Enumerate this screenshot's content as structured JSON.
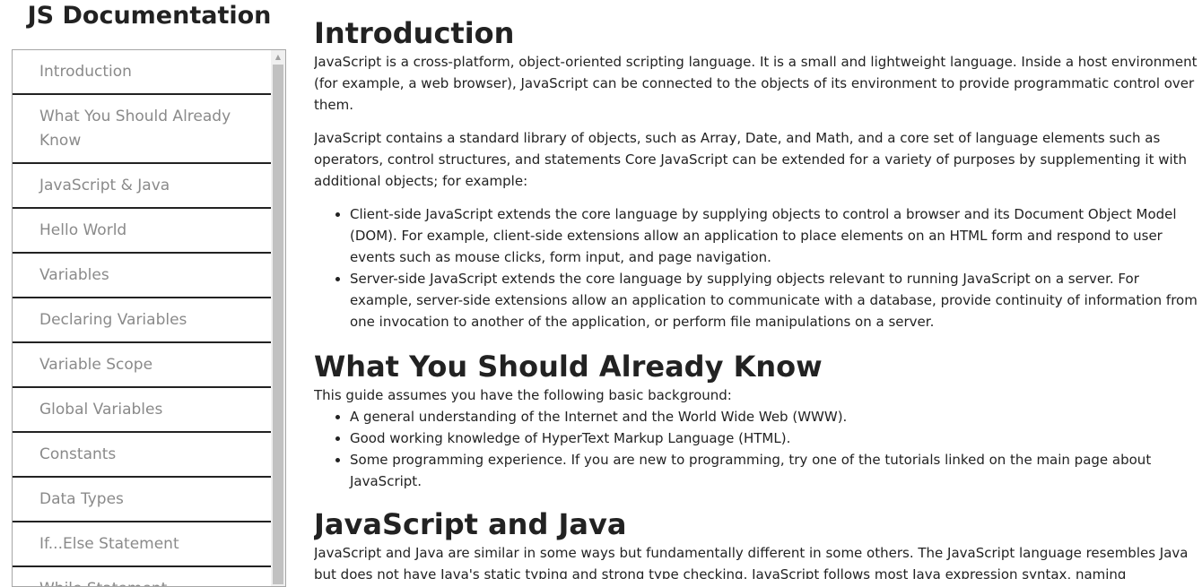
{
  "nav": {
    "title": "JS Documentation",
    "items": [
      {
        "label": "Introduction"
      },
      {
        "label": "What You Should Already Know"
      },
      {
        "label": "JavaScript & Java"
      },
      {
        "label": "Hello World"
      },
      {
        "label": "Variables"
      },
      {
        "label": "Declaring Variables"
      },
      {
        "label": "Variable Scope"
      },
      {
        "label": "Global Variables"
      },
      {
        "label": "Constants"
      },
      {
        "label": "Data Types"
      },
      {
        "label": "If...Else Statement"
      },
      {
        "label": "While Statement"
      }
    ]
  },
  "sections": {
    "intro": {
      "heading": "Introduction",
      "p1": "JavaScript is a cross-platform, object-oriented scripting language. It is a small and lightweight language. Inside a host environment (for example, a web browser), JavaScript can be connected to the objects of its environment to provide programmatic control over them.",
      "p2": "JavaScript contains a standard library of objects, such as Array, Date, and Math, and a core set of language elements such as operators, control structures, and statements Core JavaScript can be extended for a variety of purposes by supplementing it with additional objects; for example:",
      "bullets": [
        "Client-side JavaScript extends the core language by supplying objects to control a browser and its Document Object Model (DOM). For example, client-side extensions allow an application to place elements on an HTML form and respond to user events such as mouse clicks, form input, and page navigation.",
        "Server-side JavaScript extends the core language by supplying objects relevant to running JavaScript on a server. For example, server-side extensions allow an application to communicate with a database, provide continuity of information from one invocation to another of the application, or perform file manipulations on a server."
      ]
    },
    "know": {
      "heading": "What You Should Already Know",
      "p1": "This guide assumes you have the following basic background:",
      "bullets": [
        "A general understanding of the Internet and the World Wide Web (WWW).",
        "Good working knowledge of HyperText Markup Language (HTML).",
        "Some programming experience. If you are new to programming, try one of the tutorials linked on the main page about JavaScript."
      ]
    },
    "java": {
      "heading": "JavaScript and Java",
      "p1": "JavaScript and Java are similar in some ways but fundamentally different in some others. The JavaScript language resembles Java but does not have Java's static typing and strong type checking. JavaScript follows most Java expression syntax, naming conventions and basic control-flow constructs which was the reason why it was renamed from LiveScript to JavaScript."
    }
  }
}
